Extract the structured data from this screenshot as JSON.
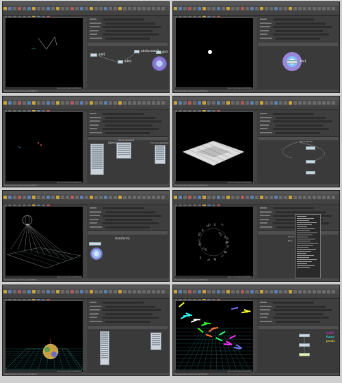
{
  "panels": [
    {
      "id": "p1",
      "node_labels": [
        "attribcreate2",
        "add1",
        "add2",
        "grid"
      ]
    },
    {
      "id": "p2",
      "node_labels": [
        "file1"
      ]
    },
    {
      "id": "p3",
      "node_labels": [
        "object",
        "Points Visualizer",
        "Font Visualization"
      ]
    },
    {
      "id": "p4",
      "node_labels": [
        "Visual Marker"
      ]
    },
    {
      "id": "p5",
      "node_labels": [
        "transform1"
      ]
    },
    {
      "id": "p6",
      "node_labels": [
        "Group",
        "Ball"
      ]
    },
    {
      "id": "p7",
      "node_labels": []
    },
    {
      "id": "p8",
      "node_labels": [
        "cutter",
        "frame",
        "pscale"
      ]
    }
  ],
  "viewport_footer": "Non-Commercial Edition",
  "footer_text": "Houdini Non-Commercial Edition",
  "colors": {
    "accent": "#c9a33a",
    "node": "#cfd8e0",
    "selected_node": "#f0f0a0",
    "viewport_bg": "#000000"
  }
}
